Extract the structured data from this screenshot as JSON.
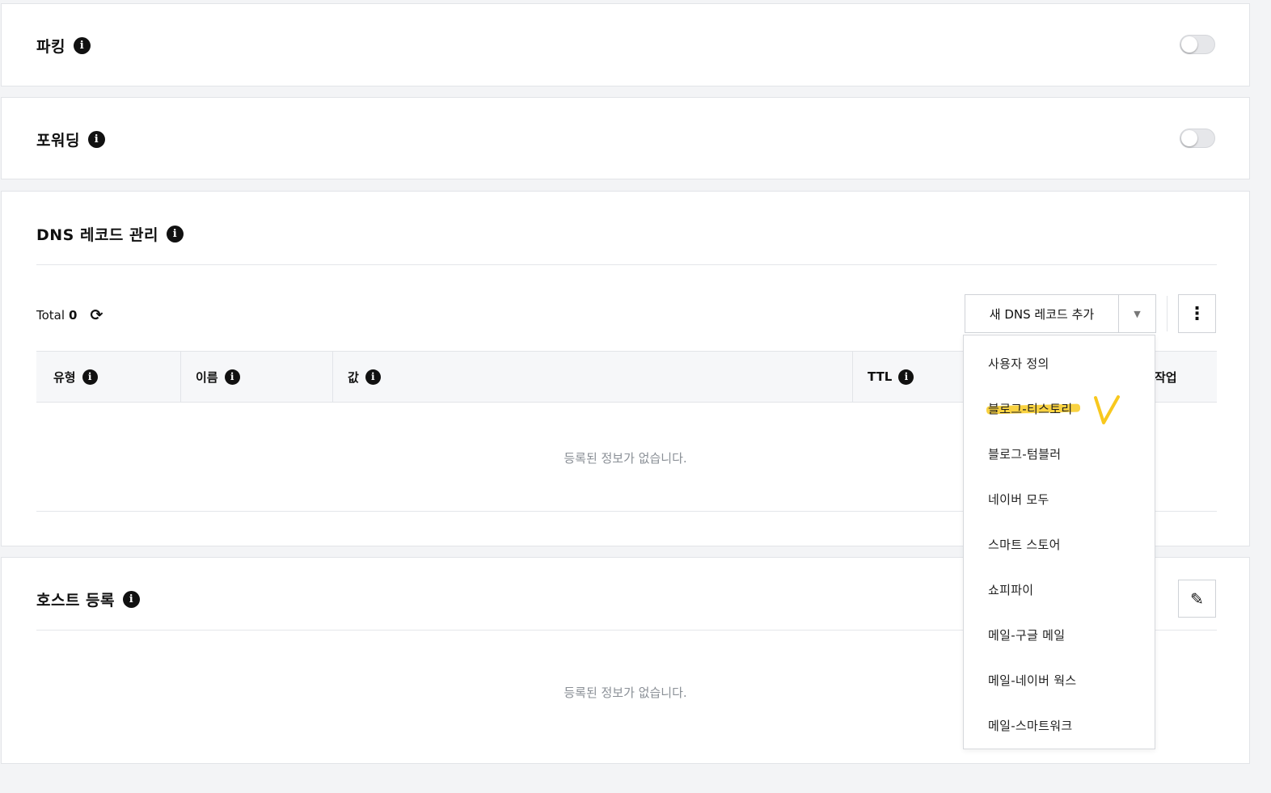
{
  "parking": {
    "title": "파킹",
    "toggle_on": false
  },
  "forwarding": {
    "title": "포워딩",
    "toggle_on": false
  },
  "dns": {
    "title": "DNS 레코드 관리",
    "total_label": "Total",
    "total_count": "0",
    "add_button_label": "새 DNS 레코드 추가",
    "columns": [
      "유형",
      "이름",
      "값",
      "TTL",
      "작업"
    ],
    "empty_text": "등록된 정보가 없습니다."
  },
  "host": {
    "title": "호스트 등록",
    "empty_text": "등록된 정보가 없습니다."
  },
  "dropdown": {
    "items": [
      "사용자 정의",
      "블로그-티스토리",
      "블로그-텀블러",
      "네이버 모두",
      "스마트 스토어",
      "쇼피파이",
      "메일-구글 메일",
      "메일-네이버 웍스",
      "메일-스마트워크"
    ],
    "highlighted_item": "블로그-티스토리",
    "highlight_color": "#f8cd2c"
  },
  "icons": {
    "info": "info-icon",
    "refresh": "refresh-icon",
    "caret": "caret-down-icon",
    "kebab": "kebab-menu-icon",
    "edit": "pencil-icon"
  }
}
